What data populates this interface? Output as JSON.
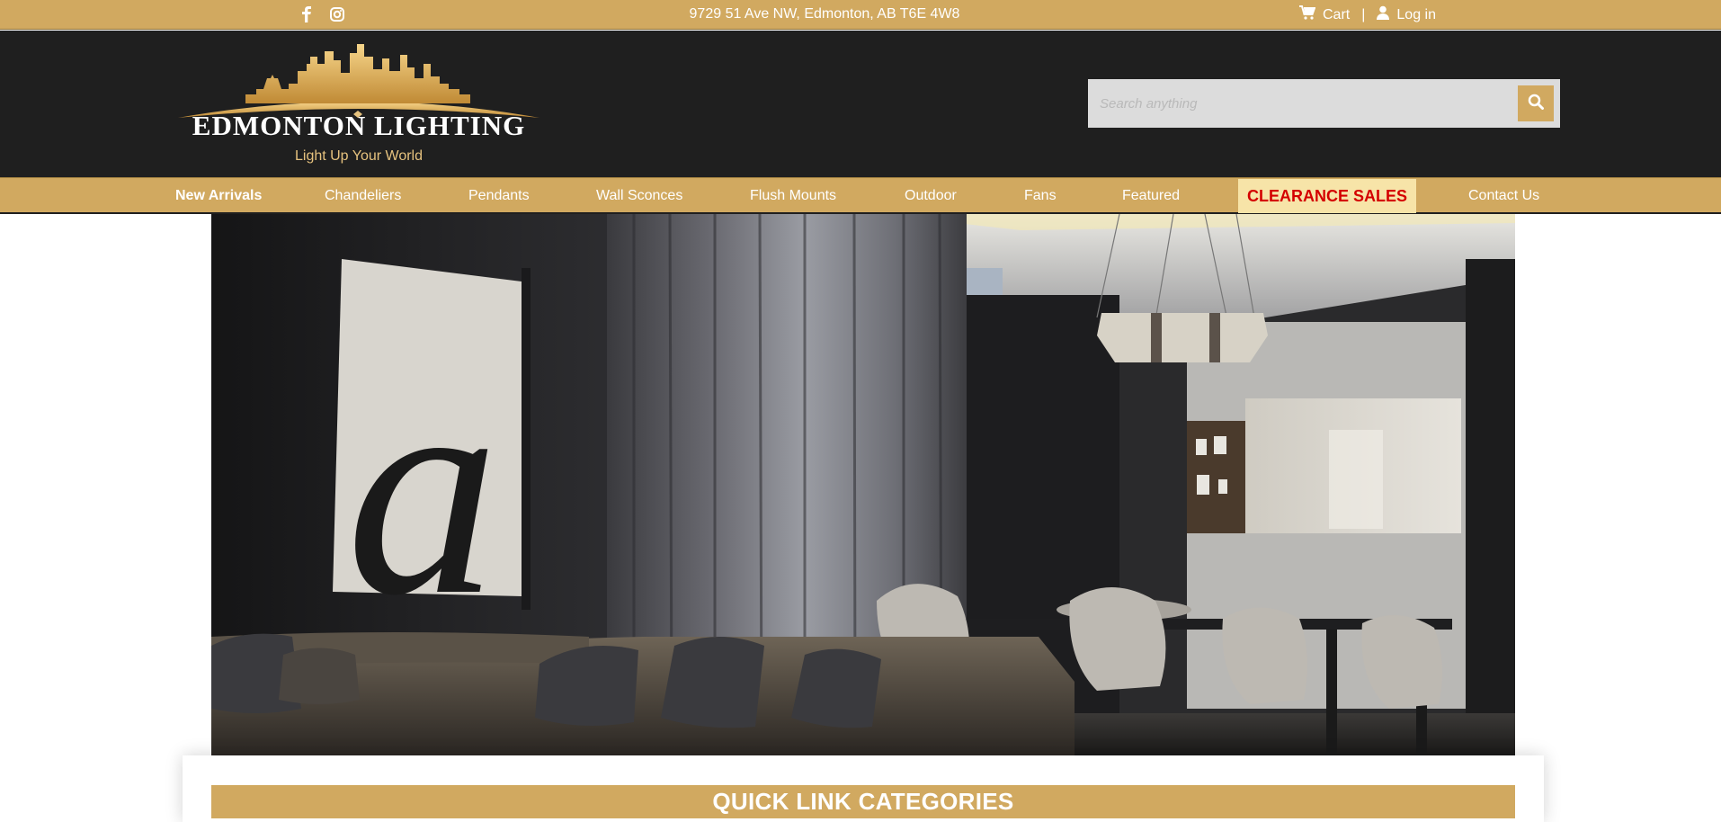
{
  "topbar": {
    "social": [
      {
        "icon": "facebook-icon"
      },
      {
        "icon": "instagram-icon"
      }
    ],
    "address": "9729 51 Ave NW, Edmonton, AB T6E 4W8",
    "cart_label": "Cart",
    "separator": "|",
    "login_label": "Log in"
  },
  "header": {
    "brand": "EDMONTON LIGHTING",
    "tagline": "Light Up Your World",
    "search_placeholder": "Search anything"
  },
  "nav": {
    "items": [
      {
        "label": "New Arrivals"
      },
      {
        "label": "Chandeliers"
      },
      {
        "label": "Pendants"
      },
      {
        "label": "Wall Sconces"
      },
      {
        "label": "Flush Mounts"
      },
      {
        "label": "Outdoor"
      },
      {
        "label": "Fans"
      },
      {
        "label": "Featured"
      },
      {
        "label": "CLEARANCE SALES"
      },
      {
        "label": "Contact Us"
      }
    ]
  },
  "hero": {
    "art_letter": "a"
  },
  "quick_links": {
    "heading": "QUICK LINK CATEGORIES"
  },
  "colors": {
    "gold": "#d1a960",
    "dark": "#1f1f1f",
    "clearance_bg": "#f7e4a8",
    "clearance_text": "#d40000"
  }
}
